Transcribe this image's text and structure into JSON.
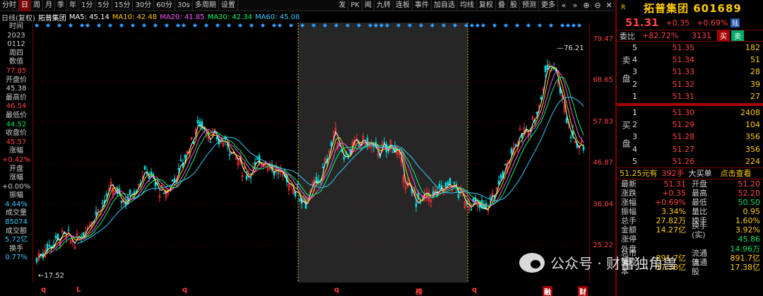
{
  "toolbar": {
    "buttons": [
      "分时",
      "日",
      "周",
      "月",
      "季",
      "年",
      "1分",
      "5分",
      "15分",
      "30分",
      "60分",
      "30s",
      "多周期",
      "设置"
    ],
    "active_index": 1,
    "right_buttons": [
      "发",
      "PK",
      "闻",
      "九转",
      "连板",
      "事件",
      "加自选",
      "均线",
      "复权",
      "叠",
      "股",
      "预测",
      "更多"
    ],
    "right_icons": [
      "«",
      "»",
      "⊕",
      "⊖",
      "✕"
    ]
  },
  "ma": {
    "chart_name": "日线(复权)",
    "stock_name": "拓普集团",
    "ma5": "MA5: 45.14",
    "ma10": "MA10: 42.48",
    "ma20": "MA20: 41.85",
    "ma30": "MA30: 42.34",
    "ma60": "MA60: 45.08",
    "colors": {
      "ma5": "#ffffff",
      "ma10": "#ffcc00",
      "ma20": "#ff55ff",
      "ma30": "#00ff66",
      "ma60": "#33ccff"
    }
  },
  "info": [
    {
      "text": "时间",
      "color": "#cccccc"
    },
    {
      "text": "2023",
      "color": "#cccccc"
    },
    {
      "text": "0112",
      "color": "#cccccc"
    },
    {
      "text": "周四",
      "color": "#cccccc"
    },
    {
      "text": "数值",
      "color": "#cccccc"
    },
    {
      "text": "77.85",
      "color": "#ff4040"
    },
    {
      "text": "开盘价",
      "color": "#cccccc"
    },
    {
      "text": "45.38",
      "color": "#cccccc"
    },
    {
      "text": "最高价",
      "color": "#cccccc"
    },
    {
      "text": "46.54",
      "color": "#ff4040"
    },
    {
      "text": "最低价",
      "color": "#cccccc"
    },
    {
      "text": "44.52",
      "color": "#00e060"
    },
    {
      "text": "收盘价",
      "color": "#cccccc"
    },
    {
      "text": "45.57",
      "color": "#ff4040"
    },
    {
      "text": "涨幅",
      "color": "#cccccc"
    },
    {
      "text": "+0.42%",
      "color": "#ff4040"
    },
    {
      "text": "开盘",
      "color": "#cccccc"
    },
    {
      "text": "涨幅",
      "color": "#cccccc"
    },
    {
      "text": "+0.00%",
      "color": "#cccccc"
    },
    {
      "text": "振幅",
      "color": "#cccccc"
    },
    {
      "text": "4.44%",
      "color": "#33ccff"
    },
    {
      "text": "成交量",
      "color": "#cccccc"
    },
    {
      "text": "85074",
      "color": "#33ccff"
    },
    {
      "text": "成交额",
      "color": "#cccccc"
    },
    {
      "text": "5.72亿",
      "color": "#33ccff"
    },
    {
      "text": "换手",
      "color": "#cccccc"
    },
    {
      "text": "0.77%",
      "color": "#33ccff"
    }
  ],
  "axis": {
    "ticks": [
      "79.47",
      "68.65",
      "57.83",
      "46.87",
      "36.04",
      "25.22"
    ],
    "tick_values": [
      79.47,
      68.65,
      57.83,
      46.87,
      36.04,
      25.22
    ]
  },
  "chart_annotations": {
    "high": "76.21",
    "low": "17.52"
  },
  "bottom_markers": [
    "q",
    "L",
    "q",
    "q",
    "榜",
    "q",
    "融",
    "财"
  ],
  "panel": {
    "logo": "R",
    "title": "拓普集团 601689",
    "price": "51.31",
    "change": "+0.35",
    "change_pct": "+0.69%",
    "lu_badge": "陆",
    "webi_label": "委比",
    "webi_value": "+82.72%",
    "webi_diff": "3131",
    "buy_btn": "买",
    "sell_btn": "卖",
    "sell_side": "卖盘",
    "buy_side": "买盘",
    "asks": [
      {
        "lv": "5",
        "px": "51.35",
        "vol": "182"
      },
      {
        "lv": "4",
        "px": "51.34",
        "vol": "51"
      },
      {
        "lv": "3",
        "px": "51.33",
        "vol": "28"
      },
      {
        "lv": "2",
        "px": "51.32",
        "vol": "39"
      },
      {
        "lv": "1",
        "px": "51.31",
        "vol": "27"
      }
    ],
    "bids": [
      {
        "lv": "1",
        "px": "51.30",
        "vol": "2408"
      },
      {
        "lv": "2",
        "px": "51.29",
        "vol": "104"
      },
      {
        "lv": "3",
        "px": "51.28",
        "vol": "356"
      },
      {
        "lv": "4",
        "px": "51.27",
        "vol": "356"
      },
      {
        "lv": "5",
        "px": "51.26",
        "vol": "224"
      }
    ],
    "big_order": {
      "price": "51.25元有",
      "qty": "392手",
      "type": "大买单",
      "link": "点击查看"
    },
    "stats": [
      {
        "k": "最新",
        "v": "51.31",
        "vc": "#ff4040",
        "k2": "开盘",
        "v2": "51.20",
        "v2c": "#ff4040"
      },
      {
        "k": "涨跌",
        "v": "+0.35",
        "vc": "#ff4040",
        "k2": "最高",
        "v2": "52.20",
        "v2c": "#ff4040"
      },
      {
        "k": "涨幅",
        "v": "+0.69%",
        "vc": "#ff4040",
        "k2": "最低",
        "v2": "50.50",
        "v2c": "#00e060"
      },
      {
        "k": "振幅",
        "v": "3.34%",
        "vc": "#ffcc00",
        "k2": "量比",
        "v2": "0.95",
        "v2c": "#ffcc00"
      },
      {
        "k": "总手",
        "v": "27.82万",
        "vc": "#ffcc00",
        "k2": "换手",
        "v2": "1.60%",
        "v2c": "#ffcc00"
      },
      {
        "k": "金额",
        "v": "14.27亿",
        "vc": "#ffcc00",
        "k2": "换手(实)",
        "v2": "3.92%",
        "v2c": "#ffcc00"
      },
      {
        "k": "涨停",
        "v": "",
        "vc": "#ff4040",
        "k2": "",
        "v2": "45.86",
        "v2c": "#00e060"
      },
      {
        "k": "外盘",
        "v": "",
        "vc": "#ff4040",
        "k2": "",
        "v2": "14.96万",
        "v2c": "#00e060"
      },
      {
        "k": "总市值",
        "v": "891.7亿",
        "vc": "#ffcc00",
        "k2": "流通值",
        "v2": "891.7亿",
        "v2c": "#ffcc00"
      },
      {
        "k": "总股本",
        "v": "17.38亿",
        "vc": "#ffcc00",
        "k2": "流通股",
        "v2": "17.38亿",
        "v2c": "#ffcc00"
      }
    ]
  },
  "watermark": {
    "text": "公众号 · 财富独角兽"
  }
}
